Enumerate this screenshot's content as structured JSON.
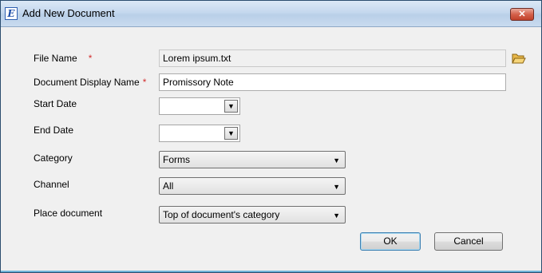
{
  "window": {
    "title": "Add New Document",
    "app_icon_letter": "E",
    "close_glyph": "✕"
  },
  "form": {
    "file_name": {
      "label": "File Name",
      "required": "*",
      "value": "Lorem ipsum.txt"
    },
    "display_name": {
      "label": "Document Display Name",
      "required": "*",
      "value": "Promissory Note"
    },
    "start_date": {
      "label": "Start Date",
      "value": ""
    },
    "end_date": {
      "label": "End Date",
      "value": ""
    },
    "category": {
      "label": "Category",
      "value": "Forms"
    },
    "channel": {
      "label": "Channel",
      "value": "All"
    },
    "place_document": {
      "label": "Place document",
      "value": "Top of document's category"
    }
  },
  "buttons": {
    "ok": "OK",
    "cancel": "Cancel"
  },
  "icons": {
    "browse": "folder-open-icon",
    "dropdown": "chevron-down-icon"
  },
  "colors": {
    "required": "#d32f2f",
    "titlebar": "#c5d8ee"
  }
}
